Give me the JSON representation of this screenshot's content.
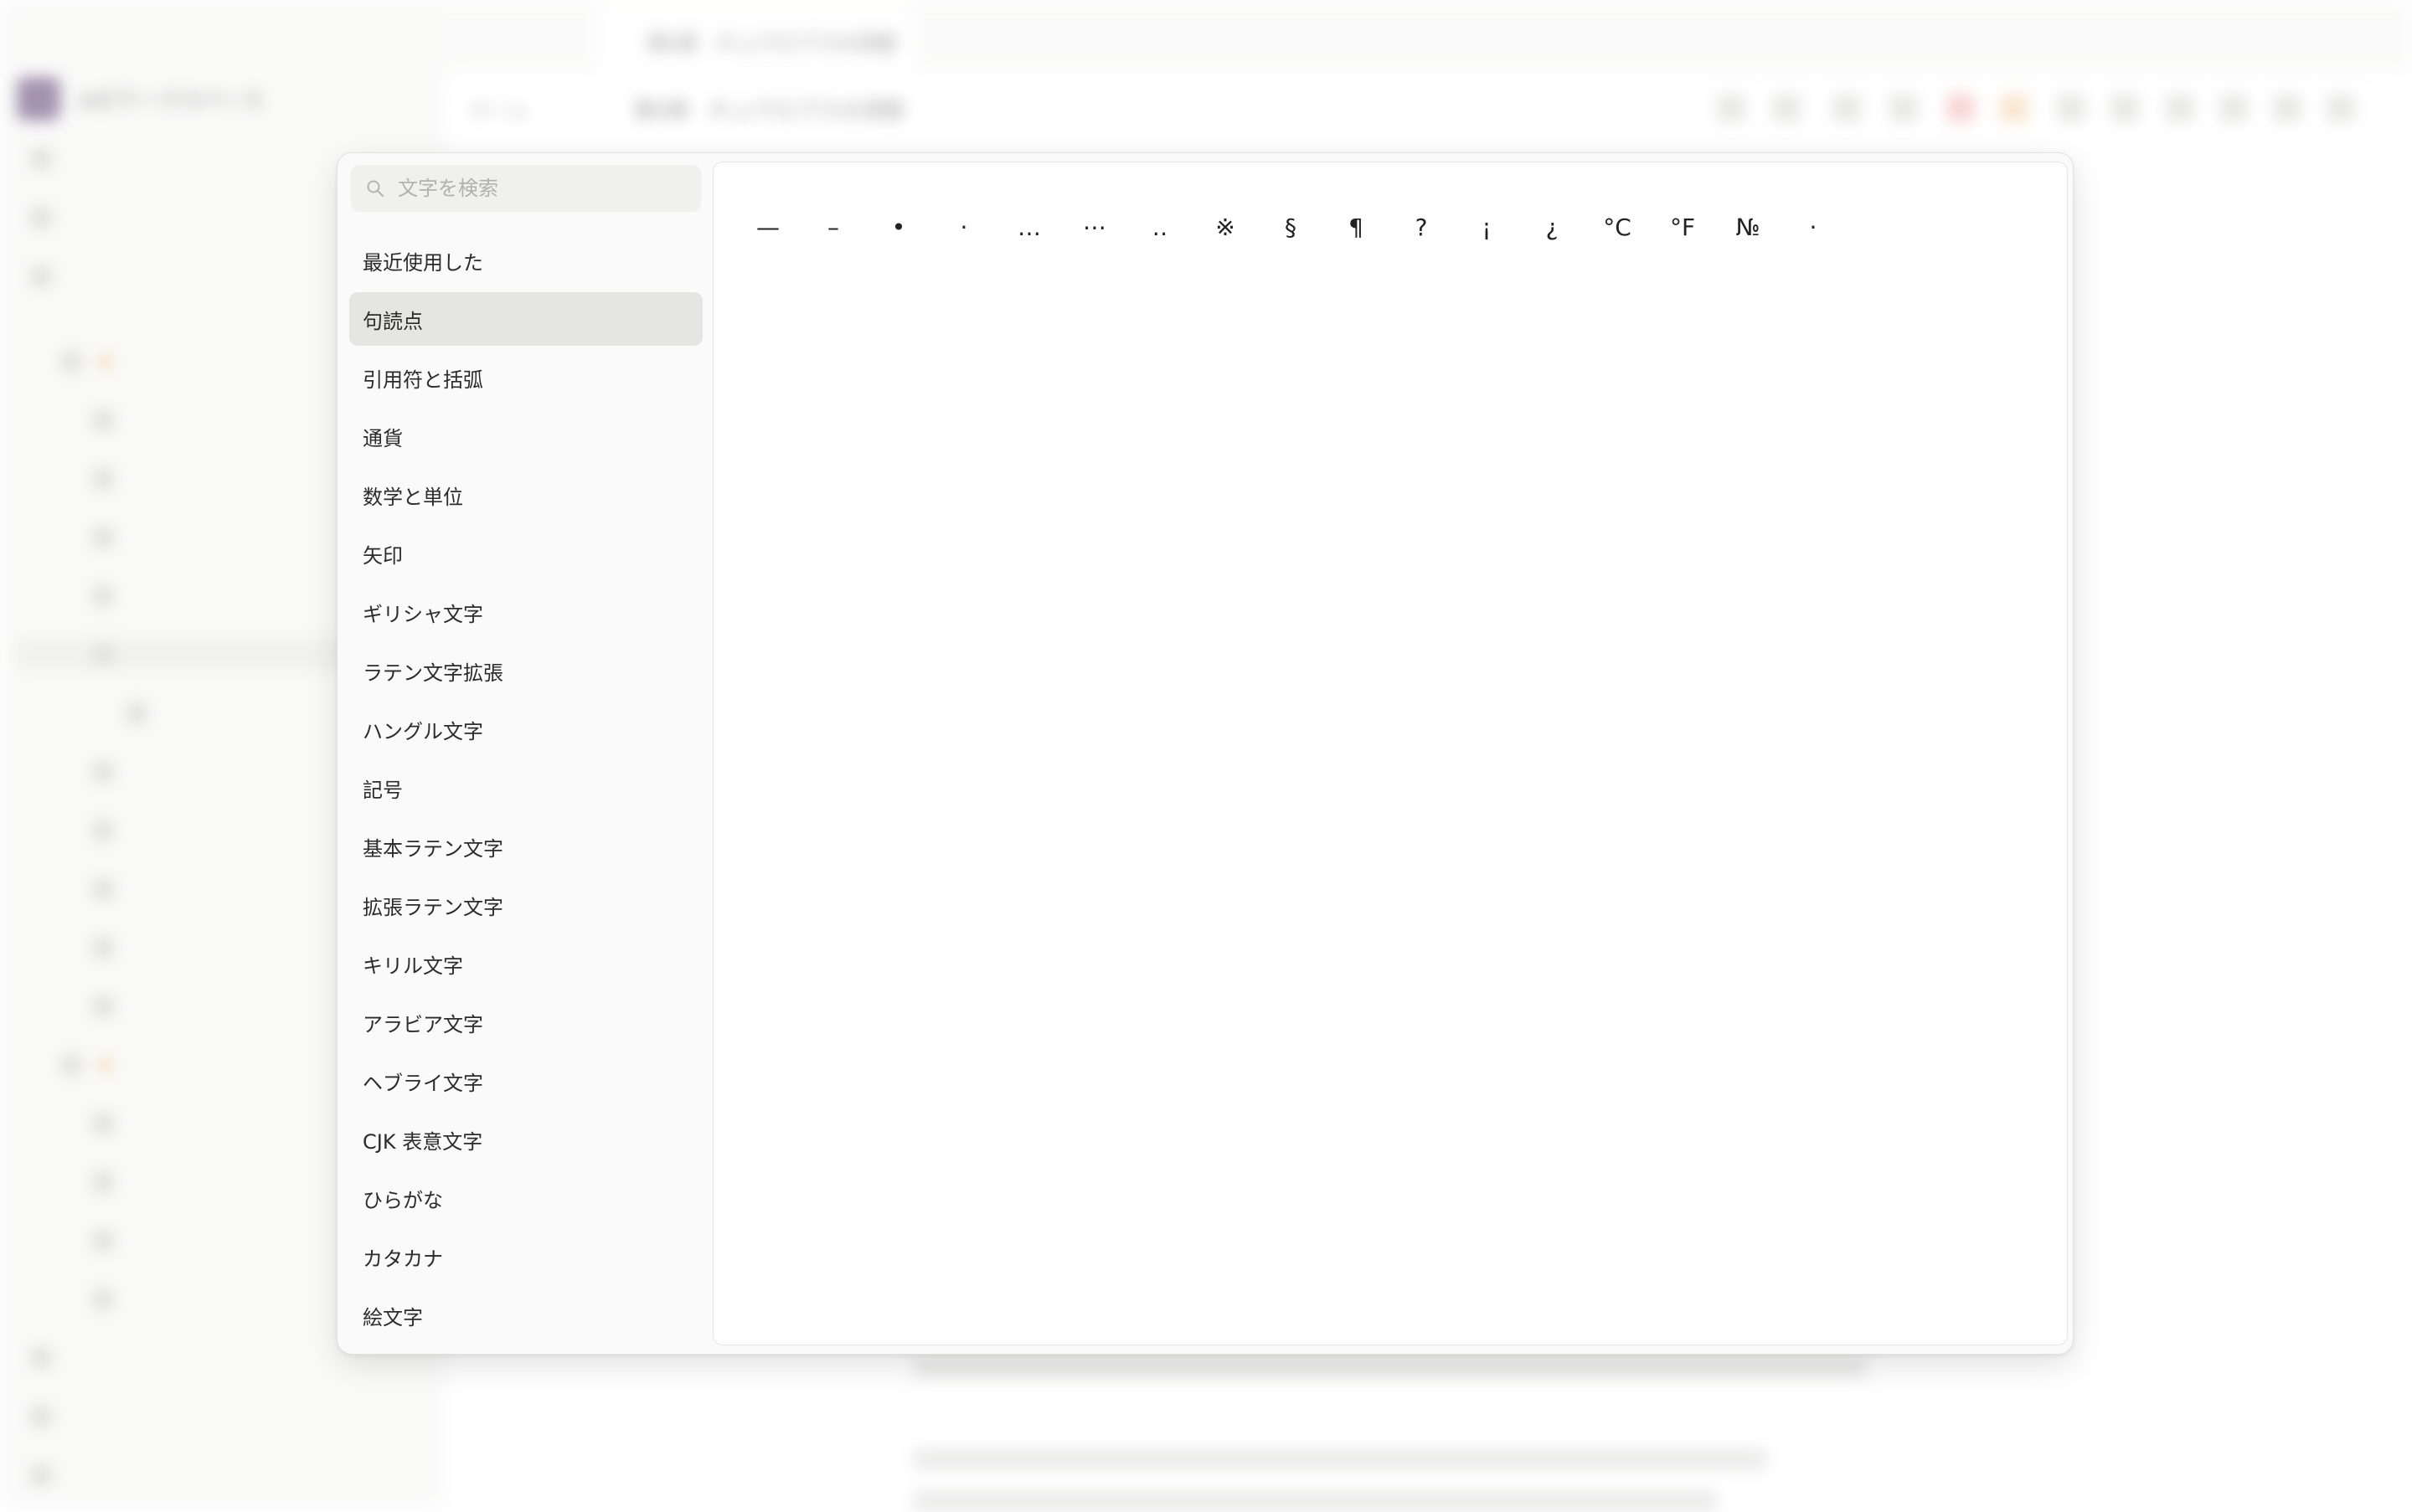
{
  "background": {
    "workspace_name": "Aのワークスペース",
    "tab_title": "第6章 · キュクロプスの洞窟",
    "breadcrumb_root": "ホーム",
    "breadcrumb_current": "第6章 · キュクロプスの洞窟"
  },
  "picker": {
    "search": {
      "placeholder": "文字を検索",
      "value": ""
    },
    "categories": [
      {
        "label": "最近使用した"
      },
      {
        "label": "句読点"
      },
      {
        "label": "引用符と括弧"
      },
      {
        "label": "通貨"
      },
      {
        "label": "数学と単位"
      },
      {
        "label": "矢印"
      },
      {
        "label": "ギリシャ文字"
      },
      {
        "label": "ラテン文字拡張"
      },
      {
        "label": "ハングル文字"
      },
      {
        "label": "記号"
      },
      {
        "label": "基本ラテン文字"
      },
      {
        "label": "拡張ラテン文字"
      },
      {
        "label": "キリル文字"
      },
      {
        "label": "アラビア文字"
      },
      {
        "label": "ヘブライ文字"
      },
      {
        "label": "CJK 表意文字"
      },
      {
        "label": "ひらがな"
      },
      {
        "label": "カタカナ"
      },
      {
        "label": "絵文字"
      }
    ],
    "active_category": "句読点",
    "characters": [
      "—",
      "–",
      "•",
      "·",
      "…",
      "⋯",
      "‥",
      "※",
      "§",
      "¶",
      "?",
      "¡",
      "¿",
      "°C",
      "°F",
      "№",
      "·"
    ]
  }
}
